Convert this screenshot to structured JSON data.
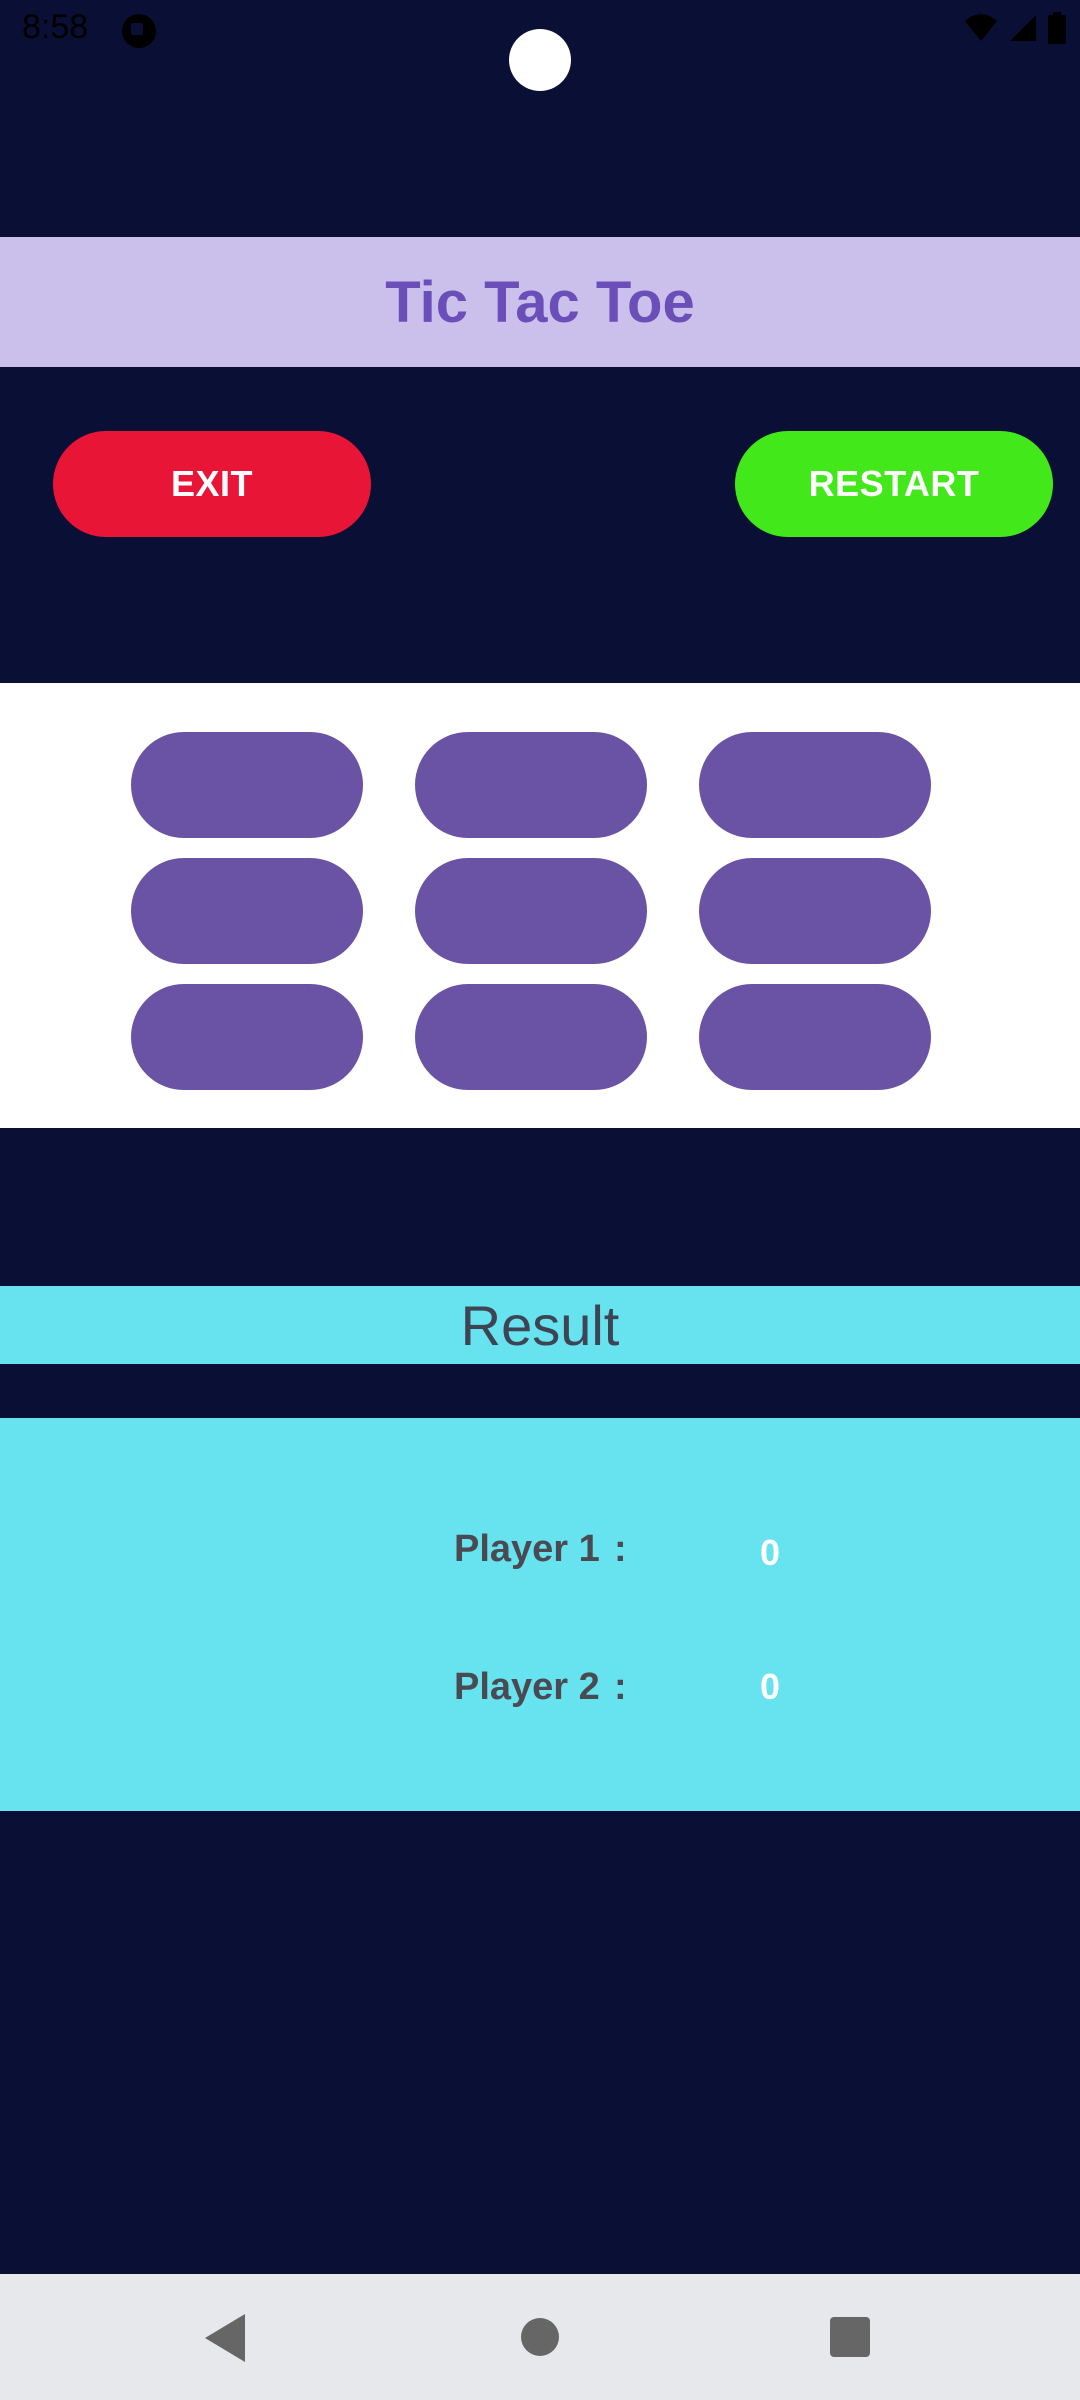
{
  "status_bar": {
    "time": "8:58",
    "icons": [
      "app-notification-icon",
      "wifi-icon",
      "cell-signal-icon",
      "battery-icon"
    ]
  },
  "header": {
    "title": "Tic Tac Toe",
    "title_color": "#6b4fb8",
    "banner_color": "#cbc0ec"
  },
  "controls": {
    "exit_label": "EXIT",
    "exit_color": "#e81537",
    "restart_label": "RESTART",
    "restart_color": "#43e81b"
  },
  "board": {
    "rows": [
      [
        "",
        "",
        ""
      ],
      [
        "",
        "",
        ""
      ],
      [
        "",
        "",
        ""
      ]
    ],
    "cell_color": "#6a53a5"
  },
  "result": {
    "heading": "Result",
    "players": [
      {
        "label": "Player 1",
        "separator": ":",
        "score": "0"
      },
      {
        "label": "Player 2",
        "separator": ":",
        "score": "0"
      }
    ],
    "panel_color": "#67e2ef"
  },
  "nav_bar": {
    "buttons": [
      "back-icon",
      "home-icon",
      "recents-icon"
    ]
  },
  "colors": {
    "background": "#0a0f35"
  }
}
